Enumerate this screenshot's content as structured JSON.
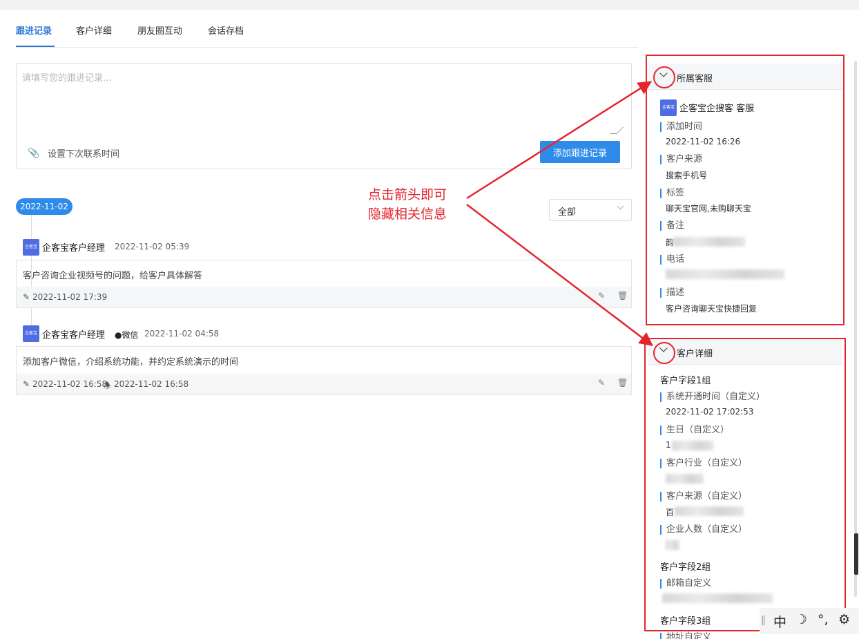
{
  "tabs": [
    "跟进记录",
    "客户详细",
    "朋友圈互动",
    "会话存档"
  ],
  "editor": {
    "placeholder": "请填写您的跟进记录...",
    "next_contact_label": "设置下次联系时间",
    "add_button": "添加跟进记录"
  },
  "timeline": {
    "date": "2022-11-02",
    "filter_value": "全部"
  },
  "records": [
    {
      "avatar_text": "企客宝",
      "author": "企客宝客户经理",
      "channel": "",
      "time": "2022-11-02 05:39",
      "content": "客户咨询企业视频号的问题，给客户具体解答",
      "edited_time": "2022-11-02 17:39",
      "remind_time": ""
    },
    {
      "avatar_text": "企客宝",
      "author": "企客宝客户经理",
      "channel": "●微信",
      "time": "2022-11-02 04:58",
      "content": "添加客户微信，介绍系统功能，并约定系统演示的时间",
      "edited_time": "2022-11-02 16:58",
      "remind_time": "2022-11-02 16:58"
    }
  ],
  "service_panel": {
    "title": "所属客服",
    "avatar_text": "企客宝",
    "agent": "企客宝企搜客 客服",
    "fields": [
      {
        "label": "添加时间",
        "value": "2022-11-02 16:26"
      },
      {
        "label": "客户来源",
        "value": "搜索手机号"
      },
      {
        "label": "标签",
        "value": "聊天宝官网,未购聊天宝"
      },
      {
        "label": "备注",
        "value": "韵"
      },
      {
        "label": "电话",
        "value": ""
      },
      {
        "label": "描述",
        "value": "客户咨询聊天宝快捷回复"
      }
    ]
  },
  "detail_panel": {
    "title": "客户详细",
    "group1": "客户字段1组",
    "group1_fields": [
      {
        "label": "系统开通时间（自定义）",
        "value": "2022-11-02 17:02:53"
      },
      {
        "label": "生日（自定义）",
        "value": "1"
      },
      {
        "label": "客户行业（自定义）",
        "value": ""
      },
      {
        "label": "客户来源（自定义）",
        "value": "百"
      },
      {
        "label": "企业人数（自定义）",
        "value": ""
      }
    ],
    "group2": "客户字段2组",
    "group2_fields": [
      {
        "label": "邮箱自定义",
        "value": ""
      }
    ],
    "group3": "客户字段3组",
    "group3_fields": [
      {
        "label": "地址自定义",
        "value": ""
      }
    ]
  },
  "annotation": {
    "line1": "点击箭头即可",
    "line2": "隐藏相关信息"
  },
  "ime": {
    "lang": "中",
    "moon": "☽",
    "punct": "°,",
    "gear": "⚙",
    "sep": "‖"
  },
  "colors": {
    "accent": "#2f8bea",
    "annotation": "#e3262d",
    "avatar": "#4f6de3"
  }
}
